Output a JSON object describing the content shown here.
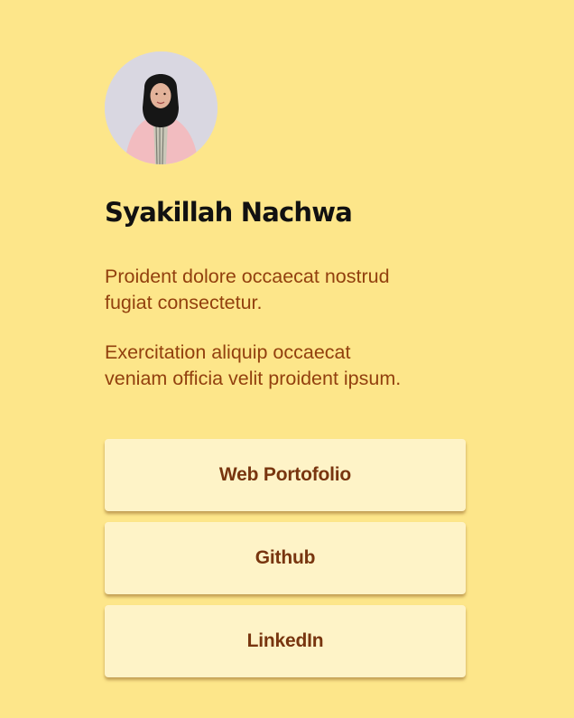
{
  "profile": {
    "name": "Syakillah Nachwa",
    "bio": [
      "Proident dolore occaecat nostrud fugiat consectetur.",
      "Exercitation aliquip occaecat veniam officia velit proident ipsum."
    ]
  },
  "links": [
    {
      "label": "Web Portofolio"
    },
    {
      "label": "Github"
    },
    {
      "label": "LinkedIn"
    }
  ],
  "colors": {
    "background": "#fde68a",
    "button_background": "#fef3c7",
    "button_text": "#78350f",
    "bio_text": "#92400e",
    "name_text": "#111111"
  }
}
